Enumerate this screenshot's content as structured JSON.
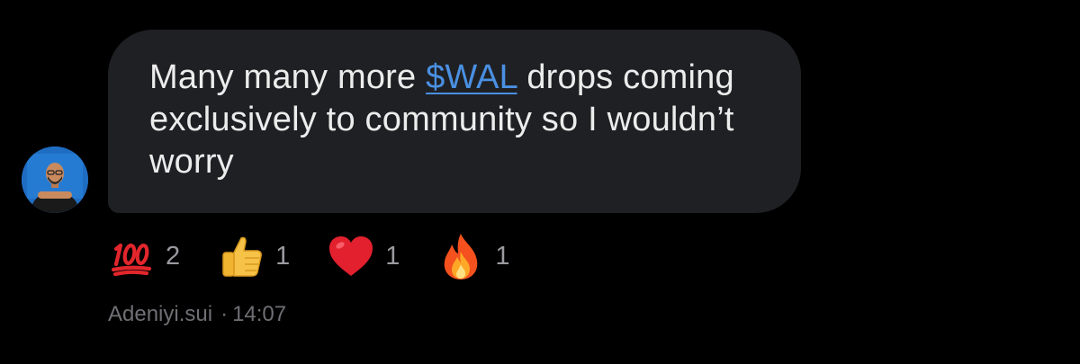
{
  "message": {
    "text_before": "Many many more ",
    "cashtag": "$WAL",
    "text_after": " drops coming exclusively to community so I wouldn’t worry"
  },
  "reactions": [
    {
      "emoji": "hundred-points-icon",
      "count": "2"
    },
    {
      "emoji": "thumbs-up-icon",
      "count": "1"
    },
    {
      "emoji": "red-heart-icon",
      "count": "1"
    },
    {
      "emoji": "fire-icon",
      "count": "1"
    }
  ],
  "meta": {
    "author": "Adeniyi.sui",
    "separator": "·",
    "time": "14:07"
  },
  "colors": {
    "background": "#000000",
    "bubble": "#1f2024",
    "link": "#4a90e2",
    "count_text": "#9a9aa0",
    "meta_text": "#6f6f75"
  }
}
